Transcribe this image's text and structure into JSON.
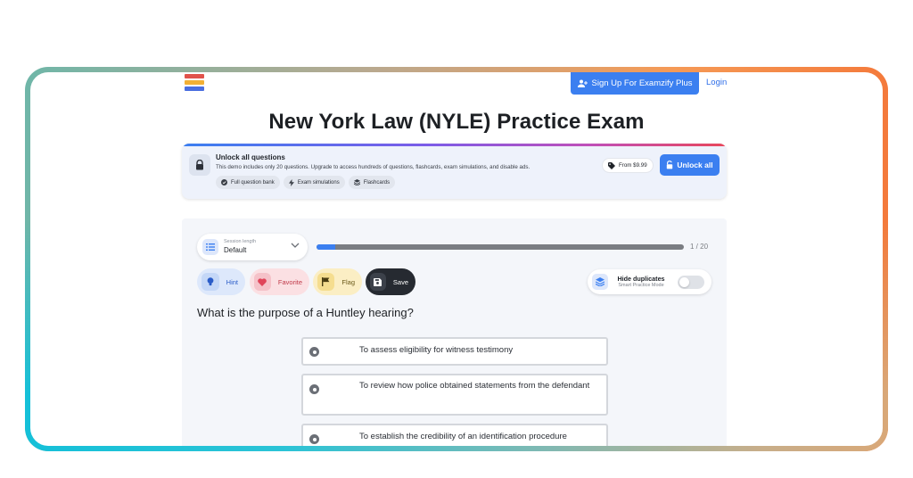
{
  "header": {
    "signup_label": "Sign Up For Examzify Plus",
    "login_label": "Login"
  },
  "page": {
    "title": "New York Law (NYLE) Practice Exam"
  },
  "promo": {
    "title": "Unlock all questions",
    "description": "This demo includes only 20 questions. Upgrade to access hundreds of questions, flashcards, exam simulations, and disable ads.",
    "features": [
      "Full question bank",
      "Exam simulations",
      "Flashcards"
    ],
    "price": "From $9.99",
    "unlock_label": "Unlock all"
  },
  "session": {
    "label": "Session length",
    "value": "Default"
  },
  "progress": {
    "current": 1,
    "total": 20,
    "text": "1 / 20",
    "fraction": 0.05
  },
  "actions": {
    "hint": "Hint",
    "favorite": "Favorite",
    "flag": "Flag",
    "save": "Save"
  },
  "duplicates": {
    "title": "Hide duplicates",
    "subtitle": "Smart Practice Mode",
    "enabled": false
  },
  "question": {
    "text": "What is the purpose of a Huntley hearing?",
    "options": [
      "To assess eligibility for witness testimony",
      "To review how police obtained statements from the defendant",
      "To establish the credibility of an identification procedure"
    ]
  },
  "colors": {
    "accent": "#3b7ff0",
    "save_bg": "#262a31"
  }
}
